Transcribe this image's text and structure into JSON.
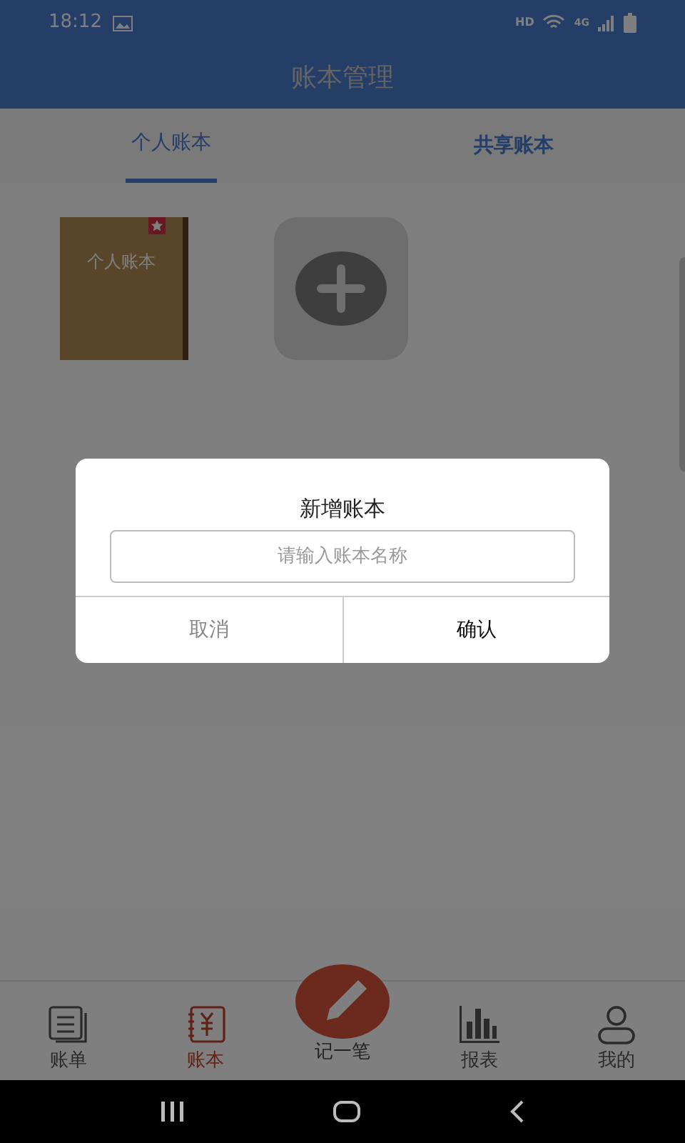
{
  "status_bar": {
    "time": "18:12",
    "network": "HD",
    "signal": "4G"
  },
  "header": {
    "title": "账本管理"
  },
  "tabs": [
    {
      "label": "个人账本",
      "selected": true
    },
    {
      "label": "共享账本",
      "selected": false
    }
  ],
  "books": [
    {
      "kind": "book",
      "title": "个人账本"
    },
    {
      "kind": "add"
    }
  ],
  "dialog": {
    "title": "新增账本",
    "placeholder": "请输入账本名称",
    "buttons": [
      {
        "label": "取消",
        "kind": "cancel"
      },
      {
        "label": "确认",
        "kind": "confirm"
      }
    ]
  },
  "bottom_nav": [
    {
      "label": "账单",
      "kind": "bill",
      "selected": false
    },
    {
      "label": "账本",
      "kind": "ledger",
      "selected": true
    },
    {
      "label": "记一笔",
      "kind": "fab",
      "selected": false
    },
    {
      "label": "报表",
      "kind": "report",
      "selected": false
    },
    {
      "label": "我的",
      "kind": "me",
      "selected": false
    }
  ]
}
